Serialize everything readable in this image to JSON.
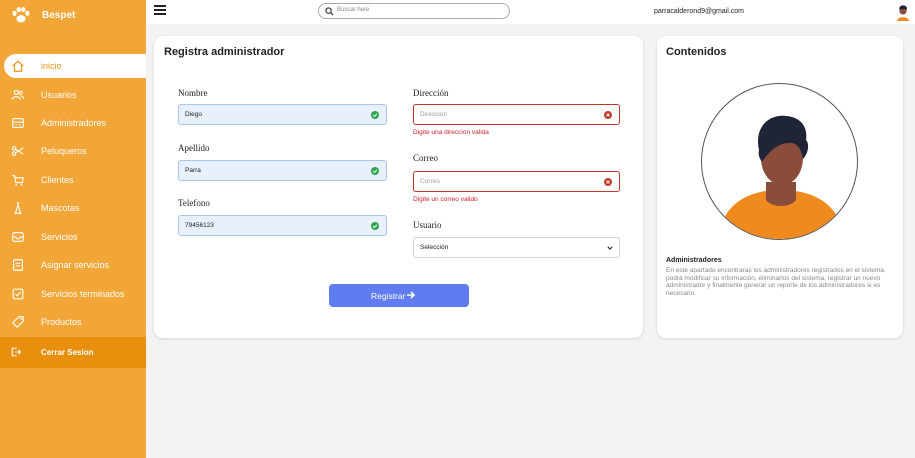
{
  "brand": {
    "name": "Bespet"
  },
  "nav": {
    "items": [
      {
        "label": "inicio",
        "icon": "home-icon"
      },
      {
        "label": "Usuarios",
        "icon": "users-icon"
      },
      {
        "label": "Administradores",
        "icon": "admin-icon"
      },
      {
        "label": "Peluqueros",
        "icon": "scissors-icon"
      },
      {
        "label": "Clientes",
        "icon": "cart-icon"
      },
      {
        "label": "Mascotas",
        "icon": "pet-icon"
      },
      {
        "label": "Servicios",
        "icon": "box-icon"
      },
      {
        "label": "Asignar servicios",
        "icon": "clipboard-icon"
      },
      {
        "label": "Servicios terminados",
        "icon": "checkbox-icon"
      },
      {
        "label": "Productos",
        "icon": "tag-icon"
      }
    ],
    "logout_label": "Cerrar Sesion"
  },
  "topbar": {
    "search_placeholder": "Buscar here",
    "email": "parracalderond9@gmail.com"
  },
  "form": {
    "title": "Registra administrador",
    "nombre": {
      "label": "Nombre",
      "value": "Diego"
    },
    "apellido": {
      "label": "Apellido",
      "value": "Parra"
    },
    "telefono": {
      "label": "Telefono",
      "value": "79456123"
    },
    "direccion": {
      "label": "Dirección",
      "placeholder": "Dirección",
      "error": "Digite una direccion valida"
    },
    "correo": {
      "label": "Correo",
      "placeholder": "Correo",
      "error": "Digite un correo valido"
    },
    "usuario": {
      "label": "Usuario",
      "selected": "Selección"
    },
    "submit_label": "Registrar"
  },
  "contents": {
    "title": "Contenidos",
    "subtitle": "Administradores",
    "description": "En este apartado encontraras los administradores registrados en el sistema, podrá modificar su información, eliminarlos del sistema, registrar un nuevo administrador y finalmente generar un reporte de los administradores si es necesario."
  },
  "colors": {
    "sidebar": "#f1a637",
    "logout_bg": "#e88f0d",
    "button": "#5f7cf0",
    "error": "#d0212a",
    "success": "#2ea44f"
  }
}
